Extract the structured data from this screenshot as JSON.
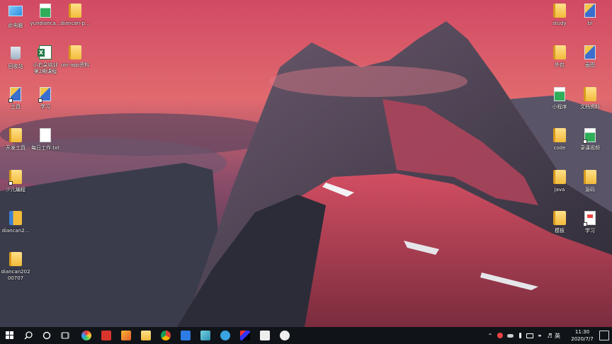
{
  "desktop": {
    "icons_left": [
      {
        "label": "此电脑",
        "type": "pc"
      },
      {
        "label": "yundianca...",
        "type": "greenfile"
      },
      {
        "label": "diancan-p...",
        "type": "folder"
      },
      {
        "label": "回收站",
        "type": "bin"
      },
      {
        "label": "小右朵培训 第2期课程大...",
        "type": "excel"
      },
      {
        "label": "uni-app资料",
        "type": "folder"
      },
      {
        "label": "工具",
        "type": "bluefile"
      },
      {
        "label": "学习",
        "type": "bluefile"
      },
      {
        "label": "开发工具",
        "type": "folder"
      },
      {
        "label": "每日工作.txt",
        "type": "doc"
      },
      {
        "label": "少儿编程",
        "type": "bluefile"
      },
      {
        "label": "diancan2...",
        "type": "zip"
      },
      {
        "label": "diancan202 00707",
        "type": "folder"
      }
    ],
    "icons_right": [
      {
        "label": "study",
        "type": "folder"
      },
      {
        "label": "bl",
        "type": "bluefile"
      },
      {
        "label": "外包",
        "type": "folder"
      },
      {
        "label": "画图",
        "type": "bluefile"
      },
      {
        "label": "小程序",
        "type": "greenfile"
      },
      {
        "label": "文档资料",
        "type": "folder"
      },
      {
        "label": "code",
        "type": "folder"
      },
      {
        "label": "录课视频",
        "type": "greenfile"
      },
      {
        "label": "java",
        "type": "folder"
      },
      {
        "label": "源码",
        "type": "folder"
      },
      {
        "label": "模板",
        "type": "folder"
      },
      {
        "label": "学习",
        "type": "pdf"
      }
    ]
  },
  "taskbar": {
    "ime": "英",
    "time": "11:30",
    "date": "2020/7/7"
  }
}
